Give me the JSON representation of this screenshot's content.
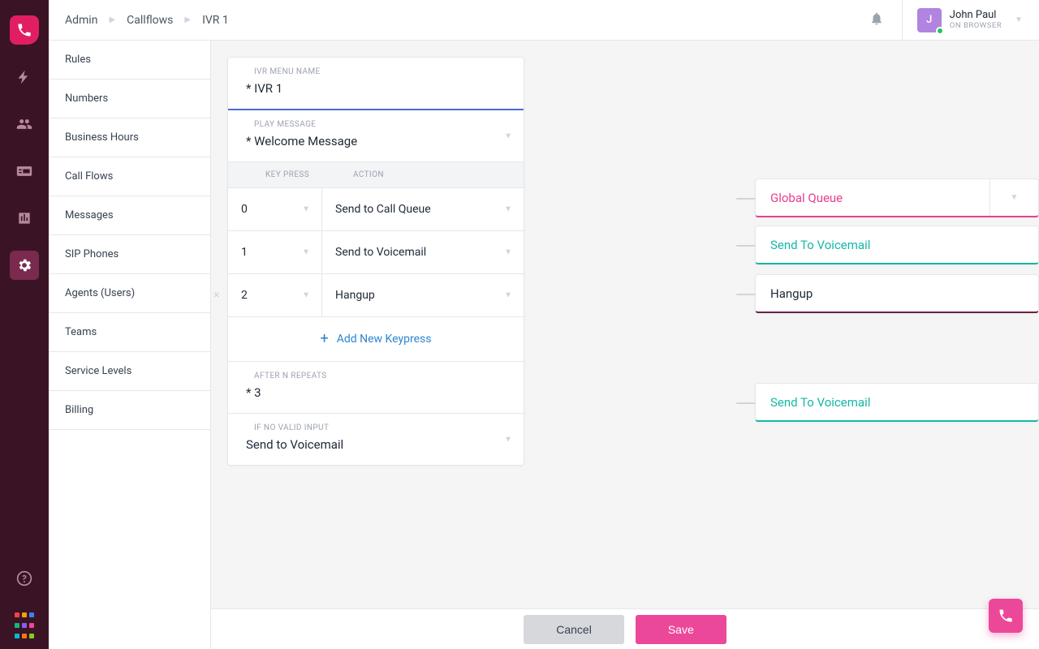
{
  "breadcrumbs": [
    "Admin",
    "Callflows",
    "IVR 1"
  ],
  "user": {
    "initial": "J",
    "name": "John Paul",
    "status": "ON BROWSER"
  },
  "sidebar": {
    "items": [
      "Rules",
      "Numbers",
      "Business Hours",
      "Call Flows",
      "Messages",
      "SIP Phones",
      "Agents (Users)",
      "Teams",
      "Service Levels",
      "Billing"
    ]
  },
  "form": {
    "nameLabel": "IVR MENU NAME",
    "nameValue": "* IVR 1",
    "playLabel": "PLAY MESSAGE",
    "playValue": "* Welcome Message",
    "keyHeader": "KEY PRESS",
    "actionHeader": "ACTION",
    "rows": [
      {
        "key": "0",
        "action": "Send to Call Queue",
        "dest": "Global Queue",
        "destStyle": "pink",
        "removable": false
      },
      {
        "key": "1",
        "action": "Send to Voicemail",
        "dest": "Send To Voicemail",
        "destStyle": "teal",
        "removable": false
      },
      {
        "key": "2",
        "action": "Hangup",
        "dest": "Hangup",
        "destStyle": "dark",
        "removable": true
      }
    ],
    "addLabel": "Add New Keypress",
    "repeatLabel": "AFTER N REPEATS",
    "repeatValue": "* 3",
    "invalidLabel": "IF NO VALID INPUT",
    "invalidValue": "Send to Voicemail",
    "invalidDest": "Send To Voicemail"
  },
  "footer": {
    "cancel": "Cancel",
    "save": "Save"
  }
}
